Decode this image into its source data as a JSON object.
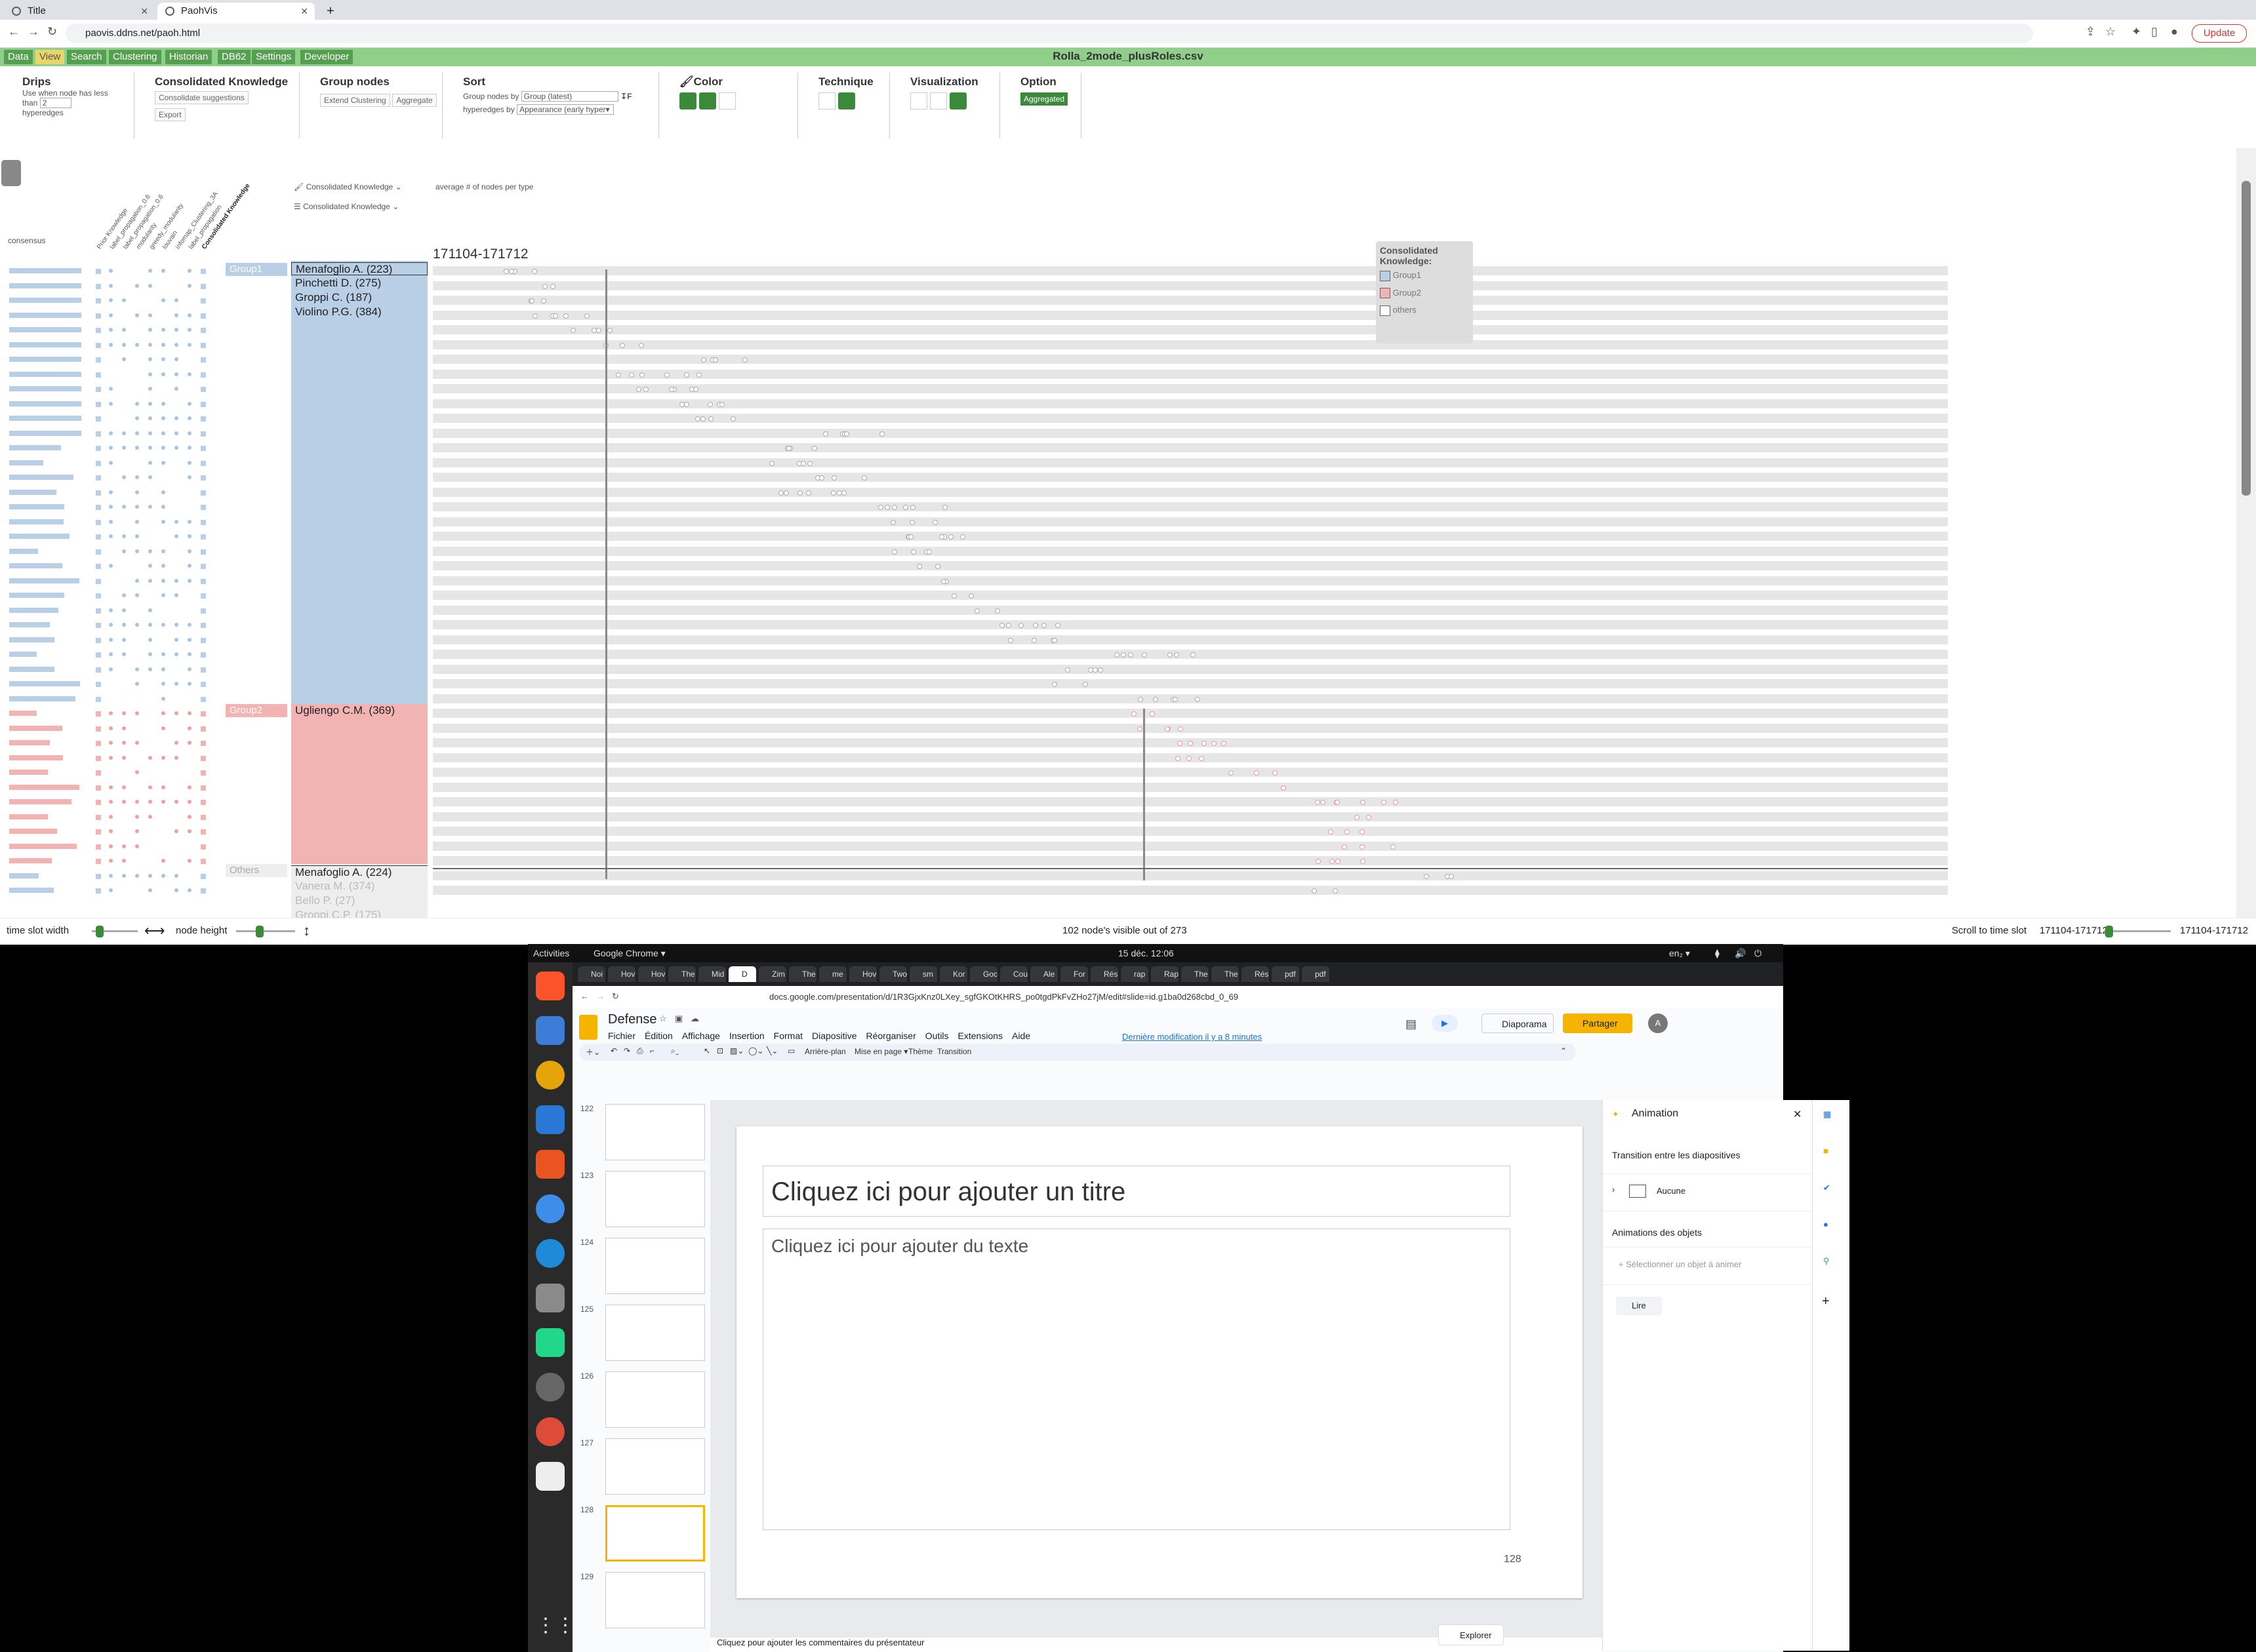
{
  "browser_top": {
    "tabs": [
      {
        "title": "Title",
        "active": false
      },
      {
        "title": "PaohVis",
        "active": true
      }
    ],
    "url": "paovis.ddns.net/paoh.html",
    "update_label": "Update"
  },
  "app": {
    "menu": [
      "Data",
      "View",
      "Search",
      "Clustering",
      "Historian",
      "DB62",
      "Settings",
      "Developer"
    ],
    "active_menu": "View",
    "file_title": "Rolla_2mode_plusRoles.csv",
    "drips": {
      "title": "Drips",
      "line1": "Use when node has less",
      "than": "than",
      "value": "2",
      "line2": "hyperedges"
    },
    "consolidated": {
      "title": "Consolidated Knowledge",
      "suggest": "Consolidate suggestions",
      "export": "Export"
    },
    "group_nodes": {
      "title": "Group nodes",
      "extend": "Extend Clustering",
      "aggregate": "Aggregate"
    },
    "sort": {
      "title": "Sort",
      "group_label": "Group nodes by",
      "group_value": "Group (latest)",
      "hyper_label": "hyperedges by",
      "hyper_value": "Appearance (early hyper▾"
    },
    "color": {
      "title": "Color"
    },
    "technique": {
      "title": "Technique"
    },
    "visualization": {
      "title": "Visualization"
    },
    "option": {
      "title": "Option",
      "aggregated": "Aggregated"
    },
    "selectors": {
      "sel1": "Consolidated Knowledge",
      "sel2": "Consolidated Knowledge",
      "sel3": "average # of nodes per type",
      "consensus": "consensus"
    },
    "column_headers": [
      "Prior Knowledge",
      "label_propagation_0.6",
      "label_propagation_0.6",
      "modularity",
      "greedy_modularity",
      "louvain",
      "infomap_Clustering_3A",
      "label_propagation",
      "Consolidated Knowledge"
    ],
    "timeslot": "171104-171712",
    "group1_label": "Group1",
    "group2_label": "Group2",
    "others_label": "Others",
    "nodes_group1": [
      "Menafoglio A. (223)",
      "Pinchetti D. (275)",
      "Groppi C. (187)",
      "Violino P.G. (384)"
    ],
    "nodes_group2": [
      "Ugliengo C.M. (369)"
    ],
    "nodes_others": [
      "Menafoglio A. (224)",
      "Vanera M. (374)",
      "Bello P. (27)",
      "Groppi C.P. (175)"
    ],
    "legend": {
      "title": "Consolidated Knowledge:",
      "items": [
        "Group1",
        "Group2",
        "others"
      ],
      "colors": [
        "#b8cfe6",
        "#f2b3b3",
        "#ffffff"
      ]
    },
    "status": {
      "time_slot_width": "time slot width",
      "node_height": "node height",
      "visible": "102 node's visible out of 273",
      "scroll_to": "Scroll to time slot",
      "slot_value": "171104-171712",
      "slot_value2": "171104-171712"
    }
  },
  "desktop": {
    "activities": "Activities",
    "app_name": "Google Chrome ▾",
    "clock": "15 déc.  12:06",
    "lang": "en₂ ▾",
    "tabs": [
      "Noi",
      "Hov",
      "Hov",
      "The",
      "Mid",
      "D",
      "Zim",
      "The",
      "me",
      "Hov",
      "Two",
      "sm",
      "Kor",
      "Goc",
      "Cou",
      "Ale",
      "For",
      "Rés",
      "rap",
      "Rap",
      "The",
      "The",
      "Rés",
      "pdf",
      "pdf"
    ],
    "url": "docs.google.com/presentation/d/1R3GjxKnz0LXey_sgfGKOtKHRS_po0tgdPkFvZHo27jM/edit#slide=id.g1ba0d268cbd_0_69"
  },
  "slides": {
    "doc_title": "Defense",
    "menus": [
      "Fichier",
      "Édition",
      "Affichage",
      "Insertion",
      "Format",
      "Diapositive",
      "Réorganiser",
      "Outils",
      "Extensions",
      "Aide"
    ],
    "last_edit": "Dernière modification il y a 8 minutes",
    "diaporama": "Diaporama",
    "partager": "Partager",
    "avatar": "A",
    "toolbar": [
      "Arrière-plan",
      "Mise en page ▾",
      "Thème",
      "Transition"
    ],
    "thumb_numbers": [
      "122",
      "123",
      "124",
      "125",
      "126",
      "127",
      "128",
      "129"
    ],
    "title_placeholder": "Cliquez ici pour ajouter un titre",
    "body_placeholder": "Cliquez ici pour ajouter du texte",
    "slide_number": "128",
    "notes": "Cliquez pour ajouter les commentaires du présentateur",
    "explorer": "Explorer",
    "panel": {
      "title": "Animation",
      "transition_heading": "Transition entre les diapositives",
      "transition_value": "Aucune",
      "objects_heading": "Animations des objets",
      "select_object": "+  Sélectionner un objet à animer",
      "play": "Lire"
    }
  }
}
